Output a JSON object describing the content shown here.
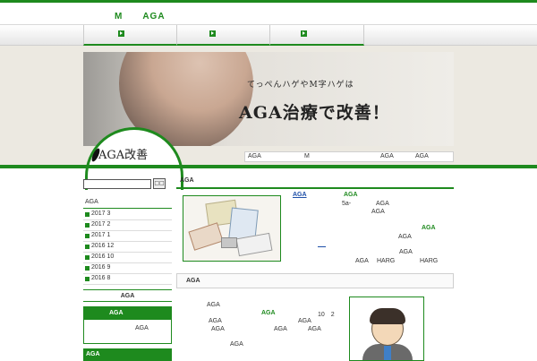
{
  "header": {
    "site_title": "M　　AGA"
  },
  "nav": {
    "items": [
      "",
      "",
      ""
    ]
  },
  "banner": {
    "subtitle": "てっぺんハゲやM字ハゲは",
    "title": "AGA治療で改善！"
  },
  "logo": {
    "text": "AGA改善"
  },
  "breadcrumb": {
    "items": [
      "AGA",
      "M",
      "AGA",
      "AGA"
    ]
  },
  "sidebar": {
    "search_button": "□□",
    "category": "AGA",
    "archives": [
      "2017 3",
      "2017 2",
      "2017 1",
      "2016 12",
      "2016 10",
      "2016 9",
      "2016 8"
    ],
    "section_head": "AGA",
    "box_head": "AGA",
    "box_text": "AGA",
    "bottom_head": "AGA"
  },
  "content": {
    "heading": "AGA",
    "post1": {
      "link": "AGA",
      "green_label": "AGA",
      "lines": [
        "5a-",
        "AGA",
        "AGA",
        "AGA",
        "AGA",
        "AGA",
        "AGA",
        "HARG",
        "HARG"
      ]
    },
    "section2": {
      "heading": "AGA",
      "lines": [
        "AGA",
        "AGA",
        "10　2",
        "AGA",
        "AGA",
        "AGA",
        "AGA",
        "AGA",
        "AGA"
      ]
    }
  },
  "colors": {
    "accent": "#1e8a1e",
    "link": "#1e4fa8"
  }
}
